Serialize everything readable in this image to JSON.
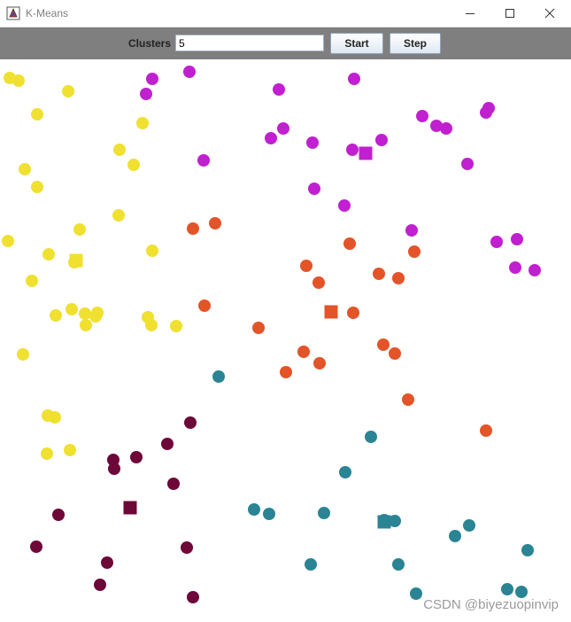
{
  "window": {
    "title": "K-Means"
  },
  "toolbar": {
    "clusters_label": "Clusters",
    "clusters_value": "5",
    "start_label": "Start",
    "step_label": "Step"
  },
  "watermark": "CSDN @biyezuopinvip",
  "colors": {
    "toolbar_bg": "#7f7f7f",
    "yellow": "#f0e030",
    "magenta": "#c020d0",
    "orange": "#e35428",
    "teal": "#2a8494",
    "maroon": "#6e0838"
  },
  "chart_data": {
    "type": "scatter",
    "grid": false,
    "clusters": [
      {
        "color": "#f0e030",
        "centroid": [
          86,
          227
        ],
        "points": [
          [
            11,
            21
          ],
          [
            21,
            24
          ],
          [
            77,
            36
          ],
          [
            42,
            62
          ],
          [
            161,
            72
          ],
          [
            135,
            102
          ],
          [
            151,
            119
          ],
          [
            28,
            124
          ],
          [
            42,
            144
          ],
          [
            134,
            176
          ],
          [
            90,
            192
          ],
          [
            9,
            205
          ],
          [
            55,
            220
          ],
          [
            84,
            229
          ],
          [
            172,
            216
          ],
          [
            36,
            250
          ],
          [
            81,
            282
          ],
          [
            63,
            289
          ],
          [
            96,
            287
          ],
          [
            110,
            286
          ],
          [
            108,
            290
          ],
          [
            167,
            291
          ],
          [
            171,
            300
          ],
          [
            97,
            300
          ],
          [
            199,
            301
          ],
          [
            26,
            333
          ],
          [
            54,
            402
          ],
          [
            62,
            404
          ],
          [
            53,
            445
          ],
          [
            79,
            441
          ]
        ]
      },
      {
        "color": "#c020d0",
        "centroid": [
          413,
          106
        ],
        "points": [
          [
            214,
            14
          ],
          [
            172,
            22
          ],
          [
            165,
            39
          ],
          [
            315,
            34
          ],
          [
            400,
            22
          ],
          [
            477,
            64
          ],
          [
            493,
            75
          ],
          [
            504,
            78
          ],
          [
            549,
            60
          ],
          [
            552,
            55
          ],
          [
            306,
            89
          ],
          [
            320,
            78
          ],
          [
            353,
            94
          ],
          [
            398,
            102
          ],
          [
            431,
            91
          ],
          [
            230,
            114
          ],
          [
            528,
            118
          ],
          [
            355,
            146
          ],
          [
            389,
            165
          ],
          [
            465,
            193
          ],
          [
            561,
            206
          ],
          [
            584,
            203
          ],
          [
            582,
            235
          ],
          [
            604,
            238
          ]
        ]
      },
      {
        "color": "#e35428",
        "centroid": [
          374,
          285
        ],
        "points": [
          [
            218,
            191
          ],
          [
            243,
            185
          ],
          [
            395,
            208
          ],
          [
            468,
            217
          ],
          [
            346,
            233
          ],
          [
            360,
            252
          ],
          [
            428,
            242
          ],
          [
            450,
            247
          ],
          [
            231,
            278
          ],
          [
            399,
            286
          ],
          [
            292,
            303
          ],
          [
            433,
            322
          ],
          [
            446,
            332
          ],
          [
            343,
            330
          ],
          [
            361,
            343
          ],
          [
            323,
            353
          ],
          [
            461,
            384
          ],
          [
            549,
            419
          ]
        ]
      },
      {
        "color": "#2a8494",
        "centroid": [
          434,
          522
        ],
        "points": [
          [
            247,
            358
          ],
          [
            419,
            426
          ],
          [
            390,
            466
          ],
          [
            287,
            508
          ],
          [
            304,
            513
          ],
          [
            366,
            512
          ],
          [
            434,
            520
          ],
          [
            446,
            521
          ],
          [
            530,
            526
          ],
          [
            514,
            538
          ],
          [
            596,
            554
          ],
          [
            351,
            570
          ],
          [
            450,
            570
          ],
          [
            470,
            603
          ],
          [
            573,
            598
          ],
          [
            589,
            601
          ]
        ]
      },
      {
        "color": "#6e0838",
        "centroid": [
          147,
          506
        ],
        "points": [
          [
            215,
            410
          ],
          [
            189,
            434
          ],
          [
            154,
            449
          ],
          [
            128,
            452
          ],
          [
            129,
            462
          ],
          [
            196,
            479
          ],
          [
            66,
            514
          ],
          [
            41,
            550
          ],
          [
            211,
            551
          ],
          [
            121,
            568
          ],
          [
            113,
            593
          ],
          [
            218,
            607
          ]
        ]
      }
    ]
  }
}
